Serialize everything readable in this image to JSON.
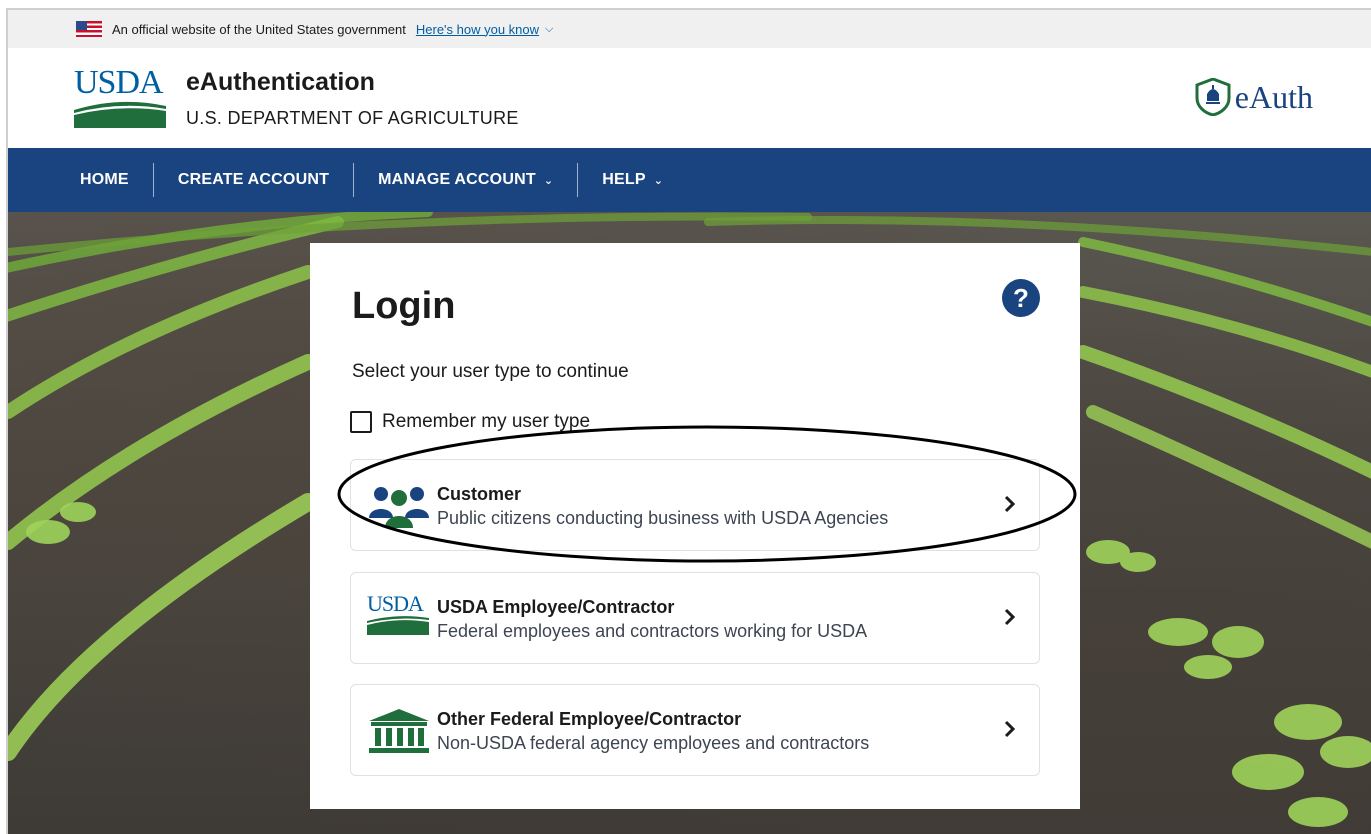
{
  "gov_banner": {
    "text": "An official website of the United States government",
    "link": "Here's how you know"
  },
  "header": {
    "logo_text": "USDA",
    "title": "eAuthentication",
    "subtitle": "U.S. DEPARTMENT OF AGRICULTURE",
    "eauth_logo_text": "eAuth"
  },
  "nav": {
    "items": [
      {
        "label": "HOME"
      },
      {
        "label": "CREATE ACCOUNT"
      },
      {
        "label": "MANAGE ACCOUNT"
      },
      {
        "label": "HELP"
      }
    ]
  },
  "login": {
    "title": "Login",
    "help_symbol": "?",
    "instructions": "Select your user type to continue",
    "remember_label": "Remember my user type",
    "options": [
      {
        "title": "Customer",
        "description": "Public citizens conducting business with USDA Agencies",
        "icon": "people-group-icon"
      },
      {
        "title": "USDA Employee/Contractor",
        "description": "Federal employees and contractors working for USDA",
        "icon": "usda-logo-icon",
        "logo_text": "USDA"
      },
      {
        "title": "Other Federal Employee/Contractor",
        "description": "Non-USDA federal agency employees and contractors",
        "icon": "government-building-icon"
      }
    ]
  },
  "colors": {
    "nav_blue": "#1a4480",
    "usda_blue": "#005ea2",
    "usda_green": "#1f6e3c",
    "link_blue": "#005ea2"
  }
}
